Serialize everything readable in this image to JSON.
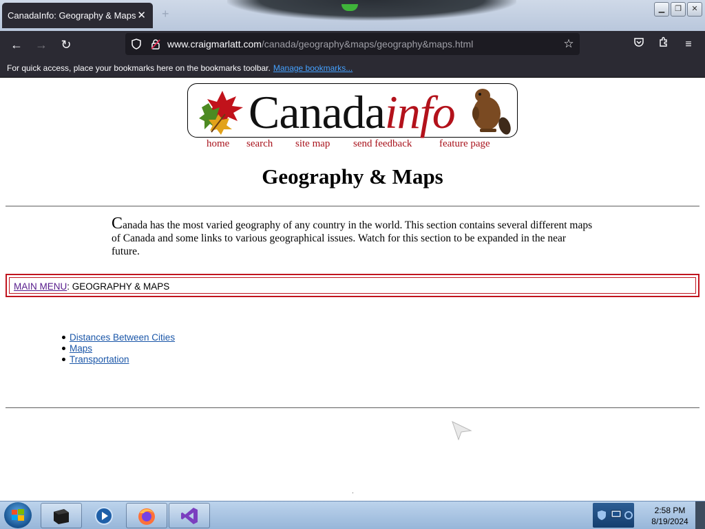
{
  "browser": {
    "tab_title": "CanadaInfo: Geography & Maps",
    "tab_close": "✕",
    "new_tab": "+",
    "url_host": "www.craigmarlatt.com",
    "url_path": "/canada/geography&maps/geography&maps.html",
    "bookmarks_message": "For quick access, place your bookmarks here on the bookmarks toolbar.",
    "manage_bookmarks": "Manage bookmarks..."
  },
  "page": {
    "logo": {
      "word": "Canada",
      "suffix": "info"
    },
    "logo_nav": [
      "home",
      "search",
      "site map",
      "send feedback",
      "feature page"
    ],
    "title": "Geography & Maps",
    "intro_dropcap": "C",
    "intro_rest": "anada has the most varied geography of any country in the world. This section contains several different maps of Canada and some links to various geographical issues. Watch for this section to be expanded in the near future.",
    "breadcrumb_link": "MAIN MENU",
    "breadcrumb_current": ": GEOGRAPHY & MAPS",
    "links": [
      "Distances Between Cities",
      "Maps",
      "Transportation"
    ]
  },
  "taskbar": {
    "time": "2:58 PM",
    "date": "8/19/2024"
  },
  "colors": {
    "browser_chrome": "#2b2a33",
    "brand_red": "#b3121b",
    "link_blue": "#1a56a8",
    "visited_purple": "#551a8b"
  }
}
